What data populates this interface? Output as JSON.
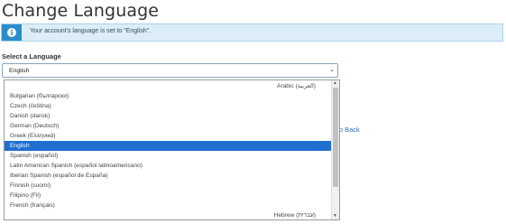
{
  "page": {
    "title": "Change Language"
  },
  "alert": {
    "text": "Your account's language is set to \"English\".",
    "icon": "info-icon"
  },
  "language_select": {
    "label": "Select a Language",
    "selected_value": "English"
  },
  "dropdown": {
    "options": [
      {
        "label": "Arabic (العربية)",
        "rtl": true,
        "selected": false
      },
      {
        "label": "Bulgarian (български)",
        "rtl": false,
        "selected": false
      },
      {
        "label": "Czech (čeština)",
        "rtl": false,
        "selected": false
      },
      {
        "label": "Danish (dansk)",
        "rtl": false,
        "selected": false
      },
      {
        "label": "German (Deutsch)",
        "rtl": false,
        "selected": false
      },
      {
        "label": "Greek (Ελληνικά)",
        "rtl": false,
        "selected": false
      },
      {
        "label": "English",
        "rtl": false,
        "selected": true
      },
      {
        "label": "Spanish (español)",
        "rtl": false,
        "selected": false
      },
      {
        "label": "Latin American Spanish (español latinoamericano)",
        "rtl": false,
        "selected": false
      },
      {
        "label": "Iberian Spanish (español de España)",
        "rtl": false,
        "selected": false
      },
      {
        "label": "Finnish (suomi)",
        "rtl": false,
        "selected": false
      },
      {
        "label": "Filipino (Fil)",
        "rtl": false,
        "selected": false
      },
      {
        "label": "French (français)",
        "rtl": false,
        "selected": false
      },
      {
        "label": "Hebrew (עברית)",
        "rtl": true,
        "selected": false
      }
    ]
  },
  "link": {
    "go_back_partial": "Go Back"
  },
  "colors": {
    "accent": "#2b8ccb",
    "selection": "#1f6fd1",
    "alert_bg": "#dcedf7",
    "link": "#2a6fb8"
  }
}
